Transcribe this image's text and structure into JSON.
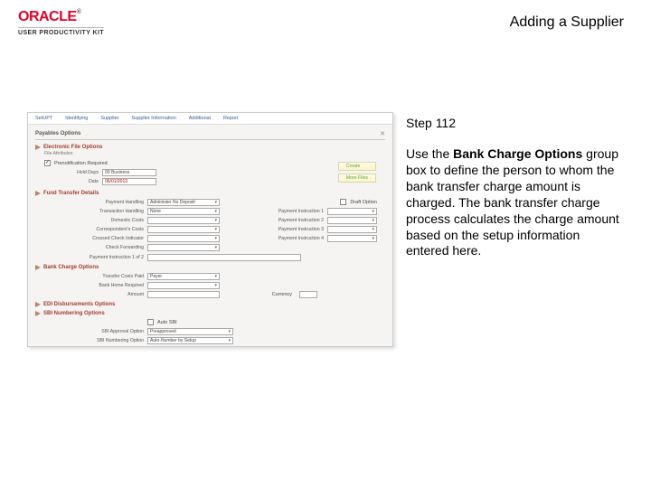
{
  "brand": {
    "name": "ORACLE",
    "tm": "®",
    "subline": "USER PRODUCTIVITY KIT"
  },
  "title": "Adding a Supplier",
  "step_label": "Step 112",
  "description_parts": {
    "pre": "Use the ",
    "bold": "Bank Charge Options",
    "post": " group box to define the person to whom the bank transfer charge amount is charged. The bank transfer charge process calculates the charge amount based on the setup information entered here."
  },
  "screenshot": {
    "tabs": [
      "SetUPT",
      "Identifying",
      "Supplier",
      "Supplier Information",
      "Additional",
      "Report"
    ],
    "page_title": "Payables Options",
    "sections": {
      "eft": {
        "title": "Electronic File Options",
        "sub": "File Attributes",
        "checkbox": "Prenotification Required",
        "hold_label": "Hold Days",
        "hold_val": "00 Business",
        "date_label": "Date",
        "date_val": "06/01/2013",
        "btn_create": "Create",
        "btn_more": "More Files"
      },
      "ft": {
        "title": "Fund Transfer Details",
        "draft": "Draft Option",
        "rows_left": [
          {
            "l": "Payment Handling",
            "v": "Administer No Deposit"
          },
          {
            "l": "Transaction Handling",
            "v": "None"
          },
          {
            "l": "Domestic Costs",
            "v": ""
          },
          {
            "l": "Correspondent's Costs",
            "v": ""
          },
          {
            "l": "Crossed Check Indicator",
            "v": ""
          },
          {
            "l": "Check Forwarding",
            "v": ""
          }
        ],
        "rows_right": [
          {
            "l": "Payment Instruction 1",
            "v": ""
          },
          {
            "l": "Payment Instruction 2",
            "v": ""
          },
          {
            "l": "Payment Instruction 3",
            "v": ""
          },
          {
            "l": "Payment Instruction 4",
            "v": ""
          }
        ],
        "pi_row": {
          "l": "Payment Instruction 1 of 2",
          "v": ""
        }
      },
      "bco": {
        "title": "Bank Charge Options",
        "rows": [
          {
            "l": "Transfer Costs Paid",
            "v": "Payer"
          },
          {
            "l": "Bank Home Required",
            "v": ""
          },
          {
            "l": "Amount",
            "v": "",
            "cur_l": "Currency",
            "cur_v": ""
          }
        ]
      },
      "edi": {
        "title": "EDI Disbursements Options"
      },
      "sbi": {
        "title": "SBI Numbering Options",
        "chk_l": "Auto SBI",
        "rows": [
          {
            "l": "SBI Approval Option",
            "v": "Preapproved"
          },
          {
            "l": "SBI Numbering Option",
            "v": "Auto-Number by Setup"
          }
        ]
      }
    }
  }
}
